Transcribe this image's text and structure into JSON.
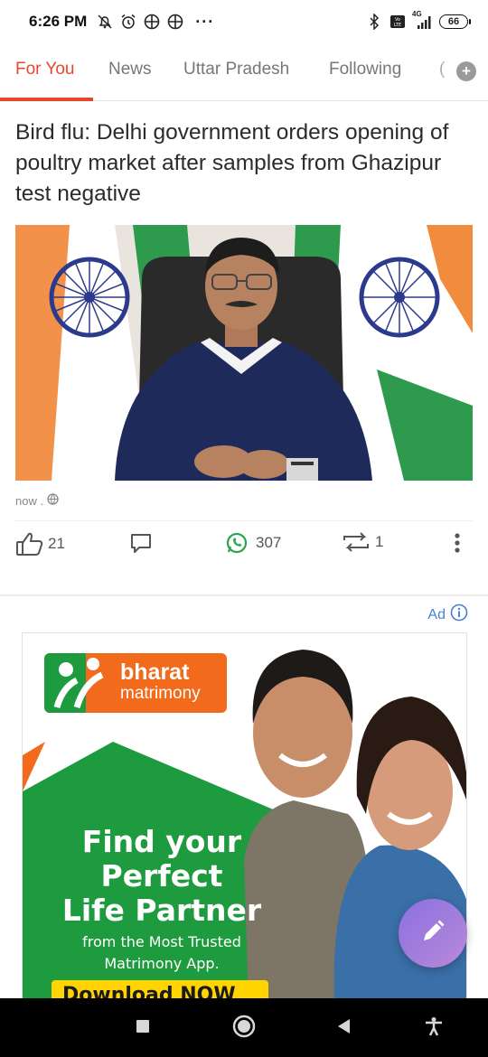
{
  "status_bar": {
    "time": "6:26 PM",
    "more": "···",
    "battery_level": "66",
    "network": "4G"
  },
  "tabs": [
    {
      "label": "For You",
      "active": true
    },
    {
      "label": "News",
      "active": false
    },
    {
      "label": "Uttar Pradesh",
      "active": false
    },
    {
      "label": "Following",
      "active": false
    },
    {
      "label": "(",
      "active": false
    }
  ],
  "tab_add_label": "+",
  "article": {
    "headline": "Bird flu: Delhi government orders opening of poultry market after samples from Ghazipur test negative",
    "time": "now .",
    "likes": "21",
    "whatsapp_shares": "307",
    "reposts": "1"
  },
  "ad": {
    "label": "Ad",
    "brand_line1": "bharat",
    "brand_line2": "matrimony",
    "headline_line1": "Find your",
    "headline_line2": "Perfect",
    "headline_line3": "Life Partner",
    "sub_line1": "from the Most Trusted",
    "sub_line2": "Matrimony App.",
    "cta": "Download NOW"
  },
  "colors": {
    "accent": "#e8472f",
    "whatsapp": "#2fa44f",
    "ad_link": "#4a7fd4",
    "ad_green": "#1f9b3f",
    "ad_orange": "#f26a1b"
  }
}
